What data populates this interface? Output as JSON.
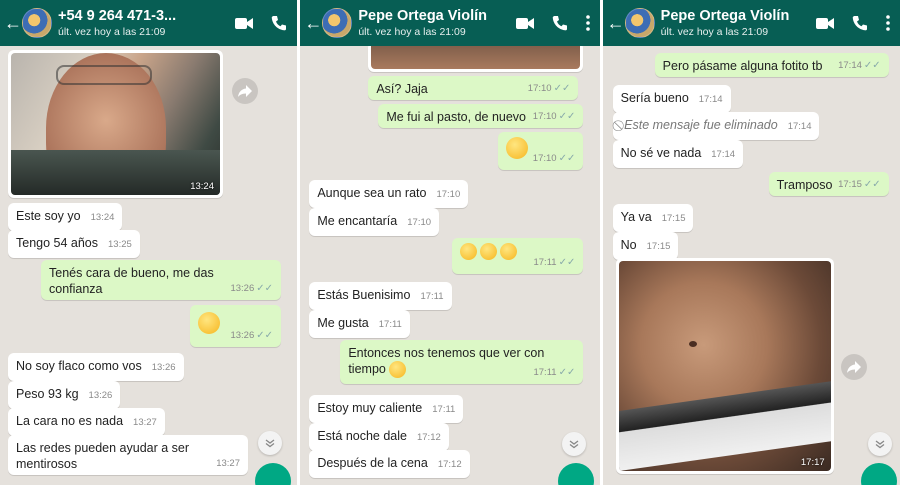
{
  "header": {
    "status": "últ. vez hoy a las 21:09"
  },
  "panels": [
    {
      "contact": "+54 9 264 471-3...",
      "photo_time": "13:24",
      "messages": [
        {
          "text": "Este soy yo",
          "time": "13:24"
        },
        {
          "text": "Tengo 54 años",
          "time": "13:25"
        },
        {
          "text": "Tenés cara de bueno, me das confianza",
          "time": "13:26"
        },
        {
          "emoji": "smiling-face",
          "time": "13:26"
        },
        {
          "text": "No soy flaco como vos",
          "time": "13:26"
        },
        {
          "text": "Peso 93 kg",
          "time": "13:26"
        },
        {
          "text": "La cara no es nada",
          "time": "13:27"
        },
        {
          "text": "Las redes pueden ayudar a ser mentirosos",
          "time": "13:27"
        }
      ]
    },
    {
      "contact": "Pepe Ortega Violín",
      "messages": [
        {
          "text": "Así? Jaja",
          "time": "17:10"
        },
        {
          "text": "Me fui al pasto, de nuevo",
          "time": "17:10"
        },
        {
          "emoji": "blushing-face",
          "time": "17:10"
        },
        {
          "text": "Aunque sea un rato",
          "time": "17:10"
        },
        {
          "text": "Me encantaría",
          "time": "17:10"
        },
        {
          "emoji": "relieved-faces",
          "time": "17:11"
        },
        {
          "text": "Estás Buenisimo",
          "time": "17:11"
        },
        {
          "text": "Me gusta",
          "time": "17:11"
        },
        {
          "text": "Entonces nos tenemos que ver con tiempo",
          "time": "17:11"
        },
        {
          "text": "Estoy muy caliente",
          "time": "17:11"
        },
        {
          "text": "Está noche dale",
          "time": "17:12"
        },
        {
          "text": "Después de la cena",
          "time": "17:12"
        }
      ]
    },
    {
      "contact": "Pepe Ortega Violín",
      "photo_time": "17:17",
      "messages": [
        {
          "text": "Pero pásame alguna fotito tb",
          "time": "17:14"
        },
        {
          "text": "Sería bueno",
          "time": "17:14"
        },
        {
          "text": "Este mensaje fue eliminado",
          "time": "17:14"
        },
        {
          "text": "No sé ve nada",
          "time": "17:14"
        },
        {
          "text": "Tramposo",
          "time": "17:15"
        },
        {
          "text": "Ya va",
          "time": "17:15"
        },
        {
          "text": "No",
          "time": "17:15"
        }
      ]
    }
  ],
  "colors": {
    "header": "#075e54",
    "chat_bg": "#e5e1dc",
    "outgoing": "#dcf8c6",
    "incoming": "#ffffff"
  }
}
